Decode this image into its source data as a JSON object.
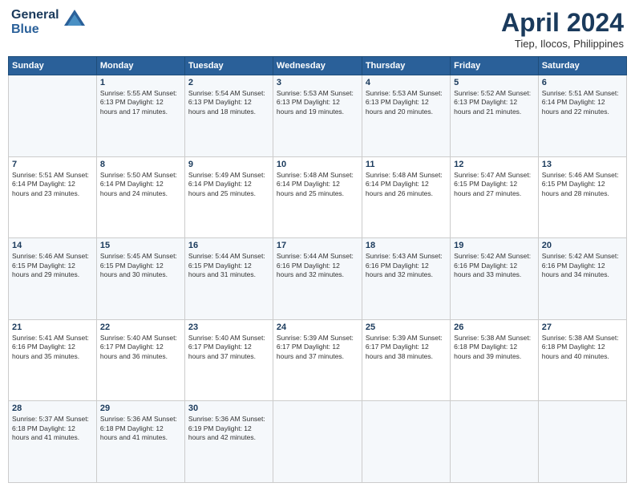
{
  "header": {
    "logo_line1": "General",
    "logo_line2": "Blue",
    "month": "April 2024",
    "location": "Tiep, Ilocos, Philippines"
  },
  "columns": [
    "Sunday",
    "Monday",
    "Tuesday",
    "Wednesday",
    "Thursday",
    "Friday",
    "Saturday"
  ],
  "weeks": [
    [
      {
        "day": "",
        "info": ""
      },
      {
        "day": "1",
        "info": "Sunrise: 5:55 AM\nSunset: 6:13 PM\nDaylight: 12 hours\nand 17 minutes."
      },
      {
        "day": "2",
        "info": "Sunrise: 5:54 AM\nSunset: 6:13 PM\nDaylight: 12 hours\nand 18 minutes."
      },
      {
        "day": "3",
        "info": "Sunrise: 5:53 AM\nSunset: 6:13 PM\nDaylight: 12 hours\nand 19 minutes."
      },
      {
        "day": "4",
        "info": "Sunrise: 5:53 AM\nSunset: 6:13 PM\nDaylight: 12 hours\nand 20 minutes."
      },
      {
        "day": "5",
        "info": "Sunrise: 5:52 AM\nSunset: 6:13 PM\nDaylight: 12 hours\nand 21 minutes."
      },
      {
        "day": "6",
        "info": "Sunrise: 5:51 AM\nSunset: 6:14 PM\nDaylight: 12 hours\nand 22 minutes."
      }
    ],
    [
      {
        "day": "7",
        "info": "Sunrise: 5:51 AM\nSunset: 6:14 PM\nDaylight: 12 hours\nand 23 minutes."
      },
      {
        "day": "8",
        "info": "Sunrise: 5:50 AM\nSunset: 6:14 PM\nDaylight: 12 hours\nand 24 minutes."
      },
      {
        "day": "9",
        "info": "Sunrise: 5:49 AM\nSunset: 6:14 PM\nDaylight: 12 hours\nand 25 minutes."
      },
      {
        "day": "10",
        "info": "Sunrise: 5:48 AM\nSunset: 6:14 PM\nDaylight: 12 hours\nand 25 minutes."
      },
      {
        "day": "11",
        "info": "Sunrise: 5:48 AM\nSunset: 6:14 PM\nDaylight: 12 hours\nand 26 minutes."
      },
      {
        "day": "12",
        "info": "Sunrise: 5:47 AM\nSunset: 6:15 PM\nDaylight: 12 hours\nand 27 minutes."
      },
      {
        "day": "13",
        "info": "Sunrise: 5:46 AM\nSunset: 6:15 PM\nDaylight: 12 hours\nand 28 minutes."
      }
    ],
    [
      {
        "day": "14",
        "info": "Sunrise: 5:46 AM\nSunset: 6:15 PM\nDaylight: 12 hours\nand 29 minutes."
      },
      {
        "day": "15",
        "info": "Sunrise: 5:45 AM\nSunset: 6:15 PM\nDaylight: 12 hours\nand 30 minutes."
      },
      {
        "day": "16",
        "info": "Sunrise: 5:44 AM\nSunset: 6:15 PM\nDaylight: 12 hours\nand 31 minutes."
      },
      {
        "day": "17",
        "info": "Sunrise: 5:44 AM\nSunset: 6:16 PM\nDaylight: 12 hours\nand 32 minutes."
      },
      {
        "day": "18",
        "info": "Sunrise: 5:43 AM\nSunset: 6:16 PM\nDaylight: 12 hours\nand 32 minutes."
      },
      {
        "day": "19",
        "info": "Sunrise: 5:42 AM\nSunset: 6:16 PM\nDaylight: 12 hours\nand 33 minutes."
      },
      {
        "day": "20",
        "info": "Sunrise: 5:42 AM\nSunset: 6:16 PM\nDaylight: 12 hours\nand 34 minutes."
      }
    ],
    [
      {
        "day": "21",
        "info": "Sunrise: 5:41 AM\nSunset: 6:16 PM\nDaylight: 12 hours\nand 35 minutes."
      },
      {
        "day": "22",
        "info": "Sunrise: 5:40 AM\nSunset: 6:17 PM\nDaylight: 12 hours\nand 36 minutes."
      },
      {
        "day": "23",
        "info": "Sunrise: 5:40 AM\nSunset: 6:17 PM\nDaylight: 12 hours\nand 37 minutes."
      },
      {
        "day": "24",
        "info": "Sunrise: 5:39 AM\nSunset: 6:17 PM\nDaylight: 12 hours\nand 37 minutes."
      },
      {
        "day": "25",
        "info": "Sunrise: 5:39 AM\nSunset: 6:17 PM\nDaylight: 12 hours\nand 38 minutes."
      },
      {
        "day": "26",
        "info": "Sunrise: 5:38 AM\nSunset: 6:18 PM\nDaylight: 12 hours\nand 39 minutes."
      },
      {
        "day": "27",
        "info": "Sunrise: 5:38 AM\nSunset: 6:18 PM\nDaylight: 12 hours\nand 40 minutes."
      }
    ],
    [
      {
        "day": "28",
        "info": "Sunrise: 5:37 AM\nSunset: 6:18 PM\nDaylight: 12 hours\nand 41 minutes."
      },
      {
        "day": "29",
        "info": "Sunrise: 5:36 AM\nSunset: 6:18 PM\nDaylight: 12 hours\nand 41 minutes."
      },
      {
        "day": "30",
        "info": "Sunrise: 5:36 AM\nSunset: 6:19 PM\nDaylight: 12 hours\nand 42 minutes."
      },
      {
        "day": "",
        "info": ""
      },
      {
        "day": "",
        "info": ""
      },
      {
        "day": "",
        "info": ""
      },
      {
        "day": "",
        "info": ""
      }
    ]
  ]
}
